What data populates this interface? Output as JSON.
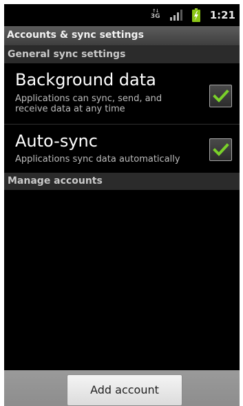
{
  "status_bar": {
    "network_label": "3G",
    "network_arrows": "↑↓",
    "signal_bars": 4,
    "signal_strength_shown": 0.75,
    "battery_level": 1.0,
    "battery_charging": true,
    "time": "1:21"
  },
  "header": {
    "title": "Accounts & sync settings"
  },
  "general_sync": {
    "category_label": "General sync settings",
    "items": [
      {
        "title": "Background data",
        "summary": "Applications can sync, send, and receive data at any time",
        "checked": true
      },
      {
        "title": "Auto-sync",
        "summary": "Applications sync data automatically",
        "checked": true
      }
    ]
  },
  "manage_accounts": {
    "category_label": "Manage accounts"
  },
  "footer": {
    "add_account_label": "Add account"
  },
  "colors": {
    "check_green": "#7ad12a",
    "battery_green": "#8bc516",
    "background": "#000000",
    "category_bg": "#2b2b2b",
    "title_bar_bg": "#4d4d4d",
    "bottom_bar_bg": "#959595"
  },
  "icons": {
    "network": "network-3g-icon",
    "signal": "signal-strength-icon",
    "battery": "battery-charging-icon",
    "check": "checkmark-icon"
  }
}
